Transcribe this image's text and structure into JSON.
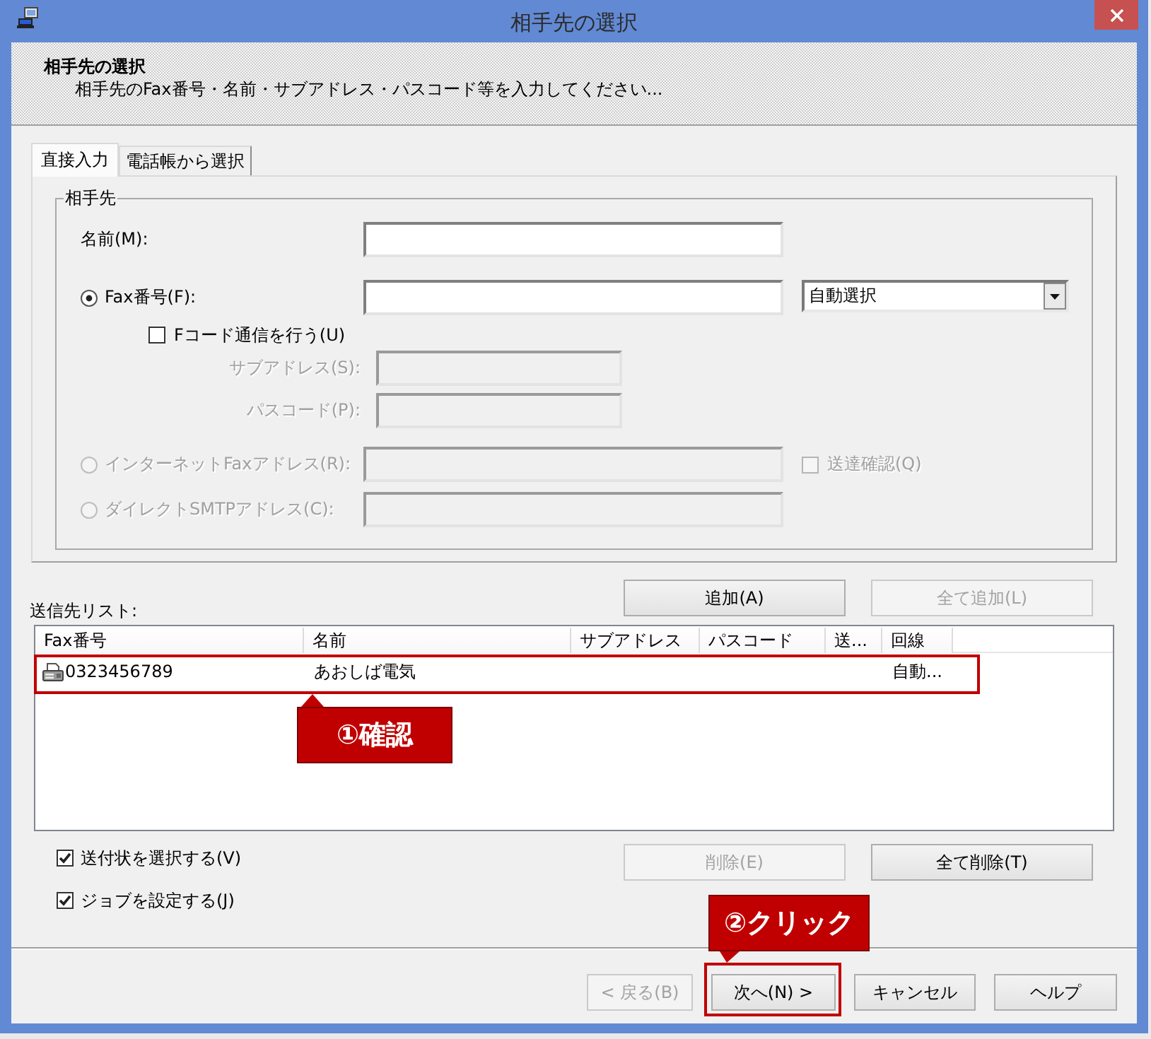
{
  "window": {
    "title": "相手先の選択"
  },
  "header": {
    "title": "相手先の選択",
    "subtitle": "相手先のFax番号・名前・サブアドレス・パスコード等を入力してください..."
  },
  "tabs": [
    {
      "label": "直接入力",
      "selected": true
    },
    {
      "label": "電話帳から選択",
      "selected": false
    }
  ],
  "recipient": {
    "title": "相手先",
    "rows": [
      {
        "kind": "text",
        "label": "名前(M):",
        "disabled": false
      },
      {
        "kind": "radio",
        "label": "Fax番号(F):",
        "selected": true,
        "disabled": false,
        "dropdown": {
          "value": "自動選択"
        }
      },
      {
        "kind": "checkbox",
        "label": "Fコード通信を行う(U)",
        "checked": false,
        "disabled": false
      },
      {
        "kind": "subfield",
        "label": "サブアドレス(S):",
        "disabled": true
      },
      {
        "kind": "subfield",
        "label": "パスコード(P):",
        "disabled": true
      },
      {
        "kind": "radio",
        "label": "インターネットFaxアドレス(R):",
        "selected": false,
        "disabled": true,
        "option": {
          "label": "送達確認(Q)",
          "checked": false,
          "disabled": true
        }
      },
      {
        "kind": "radio",
        "label": "ダイレクトSMTPアドレス(C):",
        "selected": false,
        "disabled": true
      }
    ]
  },
  "list_buttons": [
    {
      "label": "追加(A)",
      "disabled": false
    },
    {
      "label": "全て追加(L)",
      "disabled": true
    }
  ],
  "recipient_list": {
    "label": "送信先リスト:",
    "columns": [
      "Fax番号",
      "名前",
      "サブアドレス",
      "パスコード",
      "送...",
      "回線"
    ],
    "rows": [
      {
        "fax_number": "0323456789",
        "name": "あおしば電気",
        "line": "自動...",
        "selected": false,
        "annotation": "①確認"
      }
    ]
  },
  "options": [
    {
      "label": "送付状を選択する(V)",
      "checked": true
    },
    {
      "label": "ジョブを設定する(J)",
      "checked": true
    }
  ],
  "delete_buttons": [
    {
      "label": "削除(E)",
      "disabled": true
    },
    {
      "label": "全て削除(T)",
      "disabled": false
    }
  ],
  "nav_buttons": [
    {
      "label": "< 戻る(B)",
      "disabled": true
    },
    {
      "label": "次へ(N) >",
      "disabled": false,
      "annotation": "②クリック"
    },
    {
      "label": "キャンセル",
      "disabled": false
    },
    {
      "label": "ヘルプ",
      "disabled": false
    }
  ]
}
